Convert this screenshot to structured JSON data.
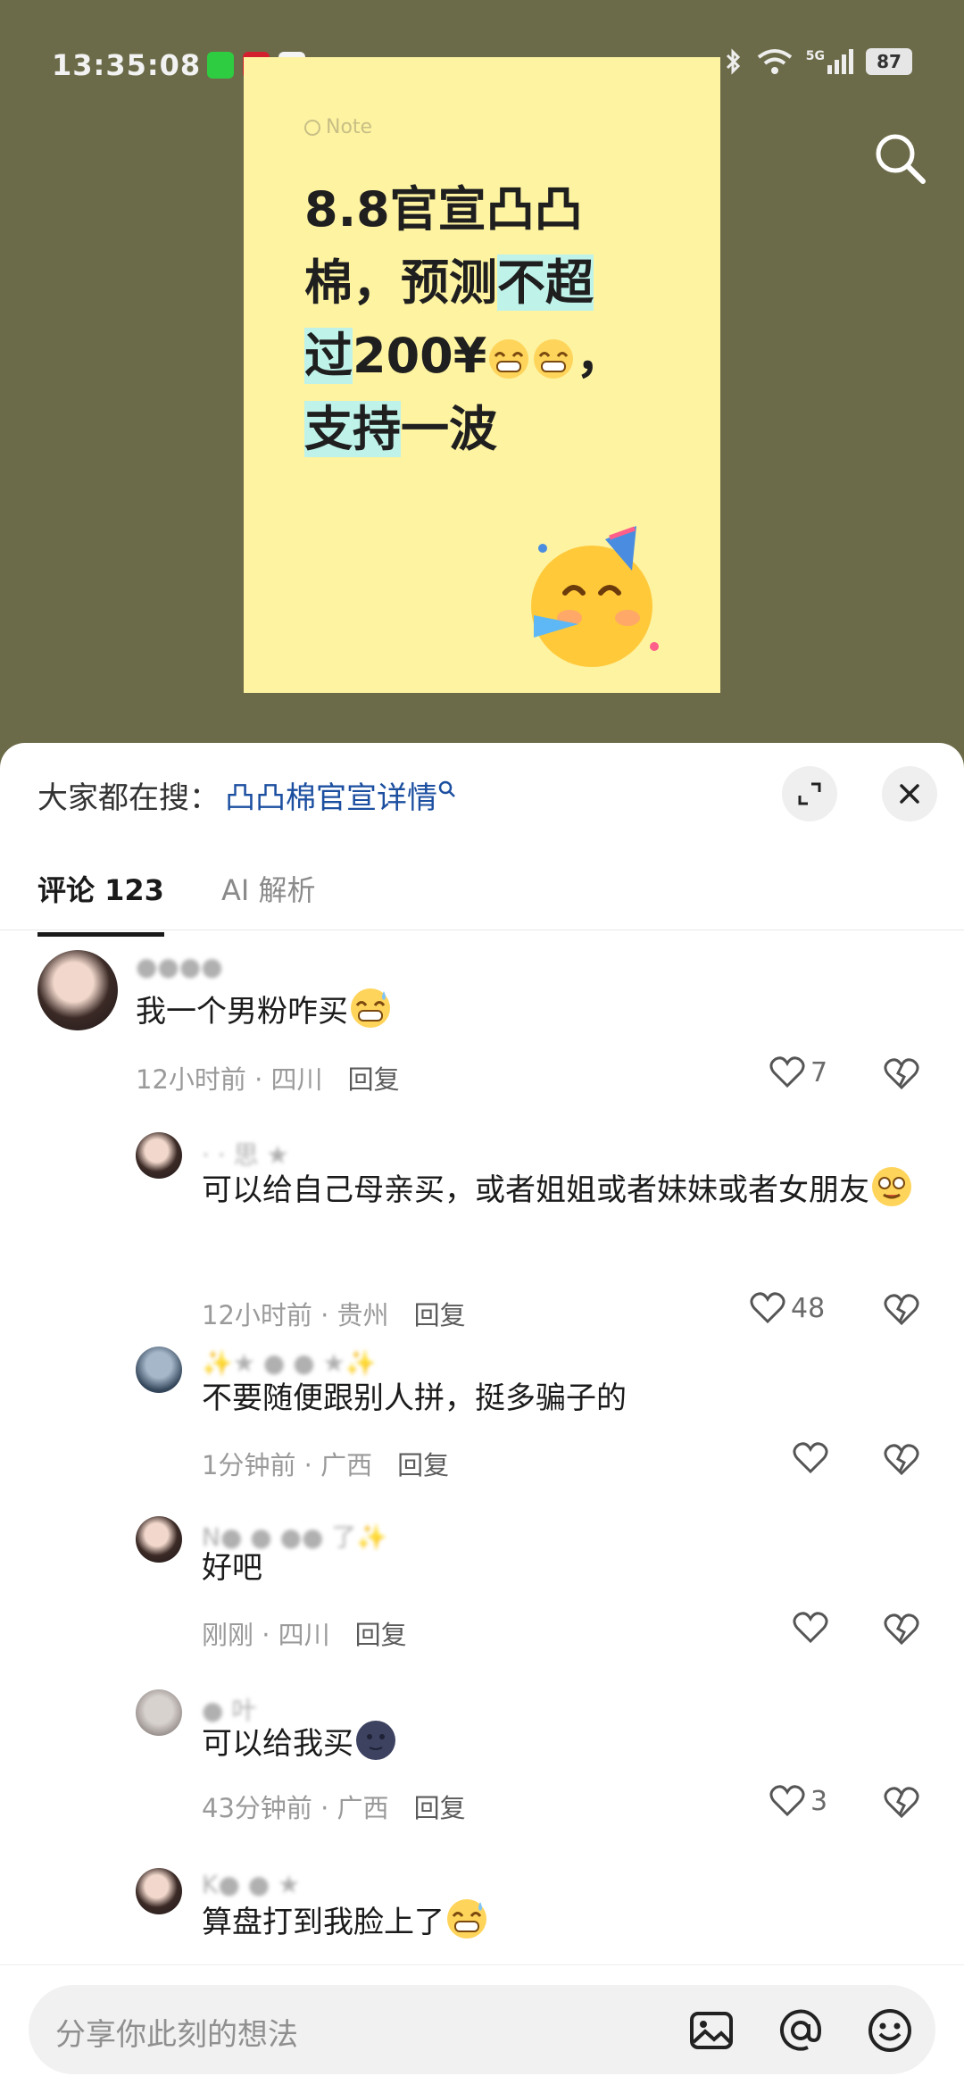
{
  "status_bar": {
    "time": "13:35:08",
    "network": "5G",
    "battery": "87"
  },
  "note": {
    "label": "Note",
    "line1": "8.8官宣凸凸",
    "line2a": "棉，预测",
    "line2b": "不超",
    "line3a": "过",
    "line3b": "200¥",
    "line3c": "，",
    "line4a": "支持",
    "line4b": "一波"
  },
  "sheet": {
    "hot_prefix": "大家都在搜：",
    "hot_link": "凸凸棉官宣详情",
    "tabs": [
      {
        "label": "评论 123"
      },
      {
        "label": "AI 解析"
      }
    ]
  },
  "comments": [
    {
      "user": "●●●●",
      "text": "我一个男粉咋买",
      "time": "12小时前 · 四川",
      "reply": "回复",
      "likes": "7"
    },
    {
      "user": "· · 思 ★",
      "text": "可以给自己母亲买，或者姐姐或者妹妹或者女朋友",
      "time": "12小时前 · 贵州",
      "reply": "回复",
      "likes": "48"
    },
    {
      "user": "✨★ ● ● ★✨",
      "text": "不要随便跟别人拼，挺多骗子的",
      "time": "1分钟前 · 广西",
      "reply": "回复",
      "likes": ""
    },
    {
      "user": "N● ● ●● 了✨",
      "text": "好吧",
      "time": "刚刚 · 四川",
      "reply": "回复",
      "likes": ""
    },
    {
      "user": "● 叶",
      "text": "可以给我买",
      "time": "43分钟前 · 广西",
      "reply": "回复",
      "likes": "3"
    },
    {
      "user": "K● ● ★",
      "text": "算盘打到我脸上了",
      "time": "",
      "reply": "",
      "likes": ""
    }
  ],
  "input": {
    "placeholder": "分享你此刻的想法"
  }
}
